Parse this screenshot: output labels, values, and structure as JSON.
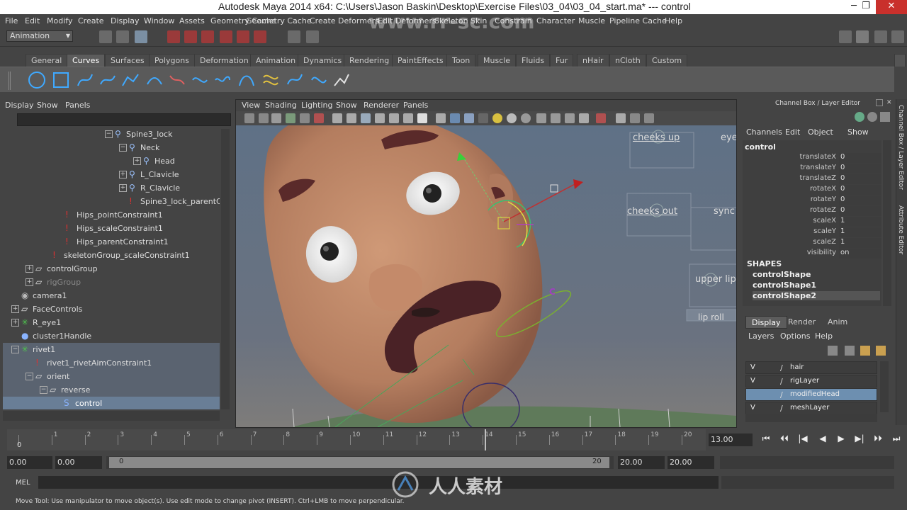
{
  "title_bar": {
    "title": "Autodesk Maya 2014 x64: C:\\Users\\Jason Baskin\\Desktop\\Exercise Files\\03_04\\03_04_start.ma*   ---   control",
    "minimize": "─",
    "maximize": "❐",
    "close": "✕"
  },
  "menu": [
    "File",
    "Edit",
    "Modify",
    "Create",
    "Display",
    "Window",
    "Assets",
    "Select",
    "Mesh",
    "Edit Deformers",
    "Skeleton",
    "Skin",
    "Constrain",
    "Character",
    "Muscle",
    "Pipeline Cache",
    "Help"
  ],
  "menu_visible": [
    "File",
    "Edit",
    "Modify",
    "Create",
    "Display",
    "Window",
    "Assets",
    "Geometry Cache",
    "Create Deformers",
    "Edit Deformers",
    "Skeleton",
    "Skin",
    "Constrain",
    "Character",
    "Muscle",
    "Pipeline Cache",
    "Help"
  ],
  "mode_selector": {
    "value": "Animation"
  },
  "shelf_tabs": [
    "General",
    "Curves",
    "Surfaces",
    "Polygons",
    "Deformation",
    "Animation",
    "Dynamics",
    "Rendering",
    "PaintEffects",
    "Toon",
    "Muscle",
    "Fluids",
    "Fur",
    "nHair",
    "nCloth",
    "Custom"
  ],
  "shelf_active": "Curves",
  "outliner": {
    "menu": [
      "Display",
      "Show",
      "Panels"
    ],
    "rows": [
      {
        "label": "Spine3_lock",
        "indent": 170,
        "icon": "joint",
        "pm": "-"
      },
      {
        "label": "Neck",
        "indent": 190,
        "icon": "joint",
        "pm": "-"
      },
      {
        "label": "Head",
        "indent": 210,
        "icon": "joint",
        "pm": "+"
      },
      {
        "label": "L_Clavicle",
        "indent": 190,
        "icon": "joint",
        "pm": "+"
      },
      {
        "label": "R_Clavicle",
        "indent": 190,
        "icon": "joint",
        "pm": "+"
      },
      {
        "label": "Spine3_lock_parentCo",
        "indent": 190,
        "icon": "constraint",
        "pm": ""
      },
      {
        "label": "Hips_pointConstraint1",
        "indent": 100,
        "icon": "constraint",
        "pm": ""
      },
      {
        "label": "Hips_scaleConstraint1",
        "indent": 100,
        "icon": "constraint",
        "pm": ""
      },
      {
        "label": "Hips_parentConstraint1",
        "indent": 100,
        "icon": "constraint",
        "pm": ""
      },
      {
        "label": "skeletonGroup_scaleConstraint1",
        "indent": 82,
        "icon": "constraint",
        "pm": ""
      },
      {
        "label": "controlGroup",
        "indent": 58,
        "icon": "group",
        "pm": "+"
      },
      {
        "label": "rigGroup",
        "indent": 58,
        "icon": "group",
        "pm": "+",
        "dim": true
      },
      {
        "label": "camera1",
        "indent": 38,
        "icon": "camera",
        "pm": ""
      },
      {
        "label": "FaceControls",
        "indent": 38,
        "icon": "group",
        "pm": "+"
      },
      {
        "label": "R_eye1",
        "indent": 38,
        "icon": "locator",
        "pm": "+"
      },
      {
        "label": "cluster1Handle",
        "indent": 38,
        "icon": "cluster",
        "pm": ""
      },
      {
        "label": "rivet1",
        "indent": 38,
        "icon": "locator",
        "pm": "-",
        "sel": 1
      },
      {
        "label": "rivet1_rivetAimConstraint1",
        "indent": 58,
        "icon": "constraint",
        "pm": "",
        "sel": 1
      },
      {
        "label": "orient",
        "indent": 58,
        "icon": "group",
        "pm": "-",
        "sel": 1
      },
      {
        "label": "reverse",
        "indent": 78,
        "icon": "group",
        "pm": "-",
        "sel": 1
      },
      {
        "label": "control",
        "indent": 98,
        "icon": "curve",
        "pm": "",
        "sel": 2
      }
    ]
  },
  "viewport": {
    "menu": [
      "View",
      "Shading",
      "Lighting",
      "Show",
      "Renderer",
      "Panels"
    ],
    "labels": {
      "cheeks_up": "cheeks up",
      "cheeks_out": "cheeks out",
      "upper_lip": "upper lip",
      "lip_roll": "lip roll",
      "sync": "sync",
      "eye": "eye",
      "manip_c": "C"
    }
  },
  "channel_box": {
    "header": "Channel Box / Layer Editor",
    "menu": [
      "Channels",
      "Edit",
      "Object",
      "Show"
    ],
    "object": "control",
    "attrs": [
      {
        "name": "translateX",
        "value": "0"
      },
      {
        "name": "translateY",
        "value": "0"
      },
      {
        "name": "translateZ",
        "value": "0"
      },
      {
        "name": "rotateX",
        "value": "0"
      },
      {
        "name": "rotateY",
        "value": "0"
      },
      {
        "name": "rotateZ",
        "value": "0"
      },
      {
        "name": "scaleX",
        "value": "1"
      },
      {
        "name": "scaleY",
        "value": "1"
      },
      {
        "name": "scaleZ",
        "value": "1"
      },
      {
        "name": "visibility",
        "value": "on"
      }
    ],
    "shapes_header": "SHAPES",
    "shapes": [
      "controlShape",
      "controlShape1",
      "controlShape2"
    ]
  },
  "layer_editor": {
    "tabs": [
      "Display",
      "Render",
      "Anim"
    ],
    "active_tab": "Display",
    "menu": [
      "Layers",
      "Options",
      "Help"
    ],
    "layers": [
      {
        "v": "V",
        "name": "hair"
      },
      {
        "v": "V",
        "name": "rigLayer"
      },
      {
        "v": "",
        "name": "modifiedHead",
        "selected": true
      },
      {
        "v": "V",
        "name": "meshLayer"
      }
    ]
  },
  "side_tabs": [
    "Channel Box / Layer Editor",
    "Attribute Editor"
  ],
  "time_slider": {
    "ticks": [
      "0",
      "1",
      "2",
      "3",
      "4",
      "5",
      "6",
      "7",
      "8",
      "9",
      "10",
      "11",
      "12",
      "13",
      "14",
      "15",
      "16",
      "17",
      "18",
      "19",
      "20"
    ],
    "current_frame": "13.00",
    "start_label": "0",
    "playback_buttons": [
      "⏮",
      "⏴⏴",
      "|◀",
      "◀",
      "▶",
      "▶|",
      "⏵⏵",
      "⏭"
    ]
  },
  "range_slider": {
    "start": "0.00",
    "anim_start": "0.00",
    "range_start": "0",
    "range_end": "20",
    "end": "20.00",
    "anim_end": "20.00"
  },
  "command_line": {
    "label": "MEL"
  },
  "help_line": {
    "text": "Move Tool: Use manipulator to move object(s). Use edit mode to change pivot (INSERT).  Ctrl+LMB to move perpendicular."
  },
  "watermarks": {
    "url1": "www.rr-sc.com",
    "brand": "人人素材"
  },
  "colors": {
    "skin": "#c28a6a",
    "skin_shadow": "#9c6650",
    "brow": "#5a2a2a",
    "mustache": "#4a2226",
    "selection": "#697e96",
    "close": "#c9302c"
  }
}
